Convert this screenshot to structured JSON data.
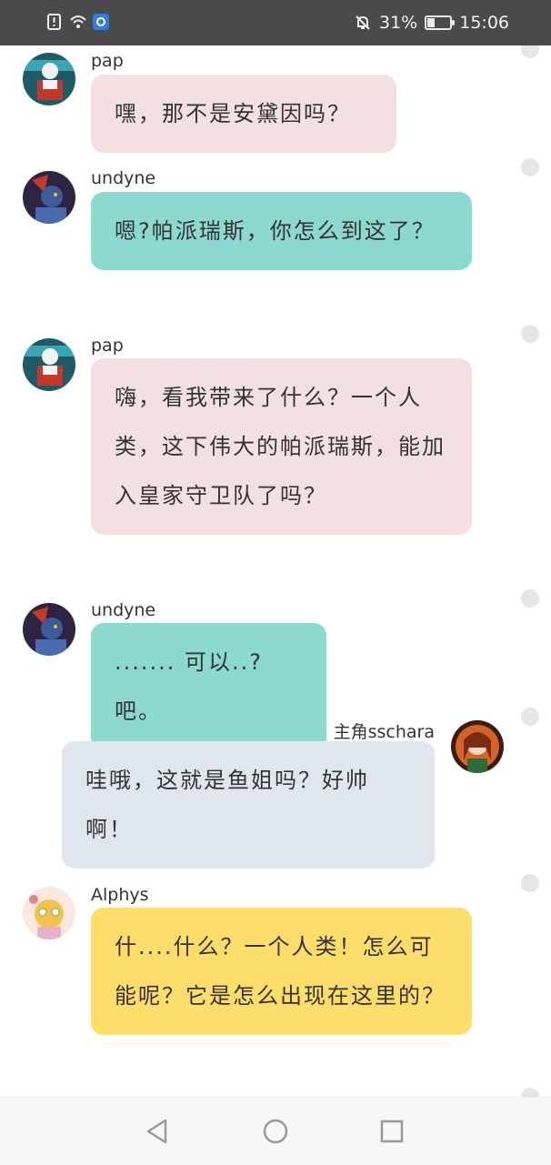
{
  "status_bar": {
    "battery_percent": "31%",
    "time": "15:06",
    "icons": [
      "alert-icon",
      "wifi-icon",
      "app-badge-icon",
      "mute-icon",
      "battery-icon"
    ]
  },
  "messages": [
    {
      "sender": "pap",
      "text": "嘿，那不是安黛因吗？",
      "side": "left",
      "color": "#f3e0e0"
    },
    {
      "sender": "undyne",
      "text": "嗯?帕派瑞斯，你怎么到这了？",
      "side": "left",
      "color": "#8cd9d0"
    },
    {
      "sender": "pap",
      "text": "嗨，看我带来了什么？一个人类，这下伟大的帕派瑞斯，能加入皇家守卫队了吗？",
      "side": "left",
      "color": "#f3e0e0"
    },
    {
      "sender": "undyne",
      "text": "....... 可以..? 吧。",
      "side": "left",
      "color": "#8cd9d0"
    },
    {
      "sender": "主角sschara",
      "text": "哇哦，这就是鱼姐吗？好帅啊！",
      "side": "right",
      "color": "#e0e6ee"
    },
    {
      "sender": "Alphys",
      "text": "什....什么？一个人类！怎么可能呢？它是怎么出现在这里的？",
      "side": "left",
      "color": "#fedd6b"
    }
  ],
  "nav": {
    "back": "back-icon",
    "home": "home-icon",
    "recents": "recents-icon"
  }
}
